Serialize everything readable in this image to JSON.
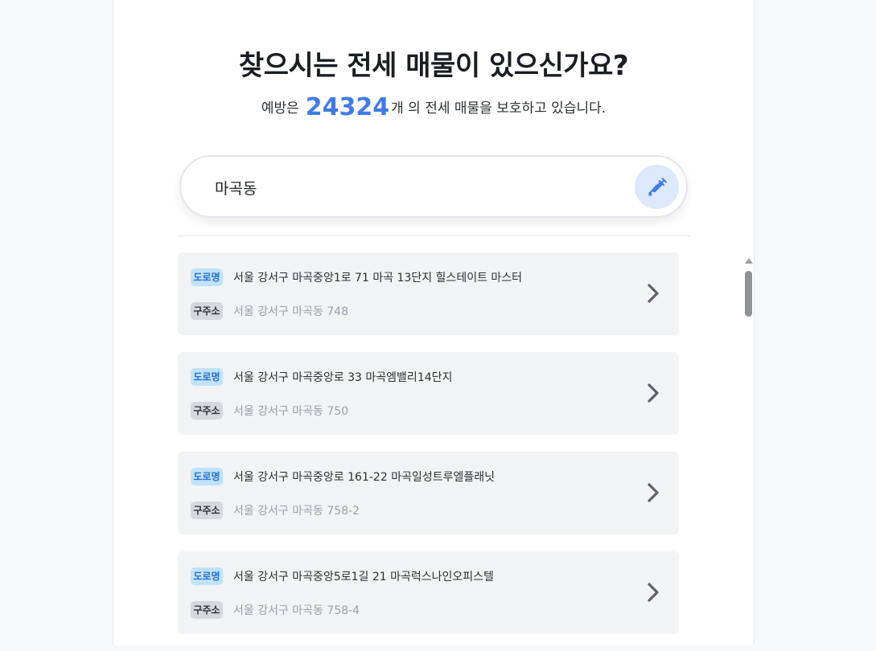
{
  "header": {
    "title": "찾으시는 전세 매물이 있으신가요?",
    "subtitle_prefix": "예방은",
    "count": "24324",
    "subtitle_suffix": "개 의 전세 매물을 보호하고 있습니다."
  },
  "search": {
    "value": "마곡동",
    "button_icon": "syringe-icon"
  },
  "results": [
    {
      "road_tag": "도로명",
      "road_address": "서울 강서구 마곡중앙1로 71 마곡 13단지 힐스테이트 마스터",
      "lot_tag": "구주소",
      "lot_address": "서울 강서구 마곡동 748"
    },
    {
      "road_tag": "도로명",
      "road_address": "서울 강서구 마곡중앙로 33 마곡엠밸리14단지",
      "lot_tag": "구주소",
      "lot_address": "서울 강서구 마곡동 750"
    },
    {
      "road_tag": "도로명",
      "road_address": "서울 강서구 마곡중앙로 161-22 마곡일성트루엘플래닛",
      "lot_tag": "구주소",
      "lot_address": "서울 강서구 마곡동 758-2"
    },
    {
      "road_tag": "도로명",
      "road_address": "서울 강서구 마곡중앙5로1길 21 마곡럭스나인오피스텔",
      "lot_tag": "구주소",
      "lot_address": "서울 강서구 마곡동 758-4"
    }
  ],
  "colors": {
    "accent": "#3f7be8",
    "road_tag_bg": "#bfe3fb",
    "lot_tag_bg": "#d6d8dc",
    "card_bg": "#f2f3f5"
  }
}
